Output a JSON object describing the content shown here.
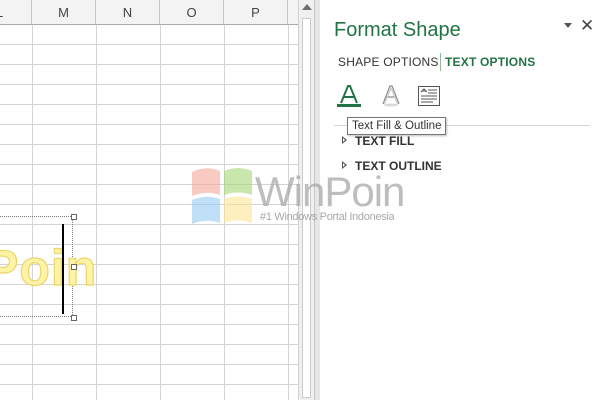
{
  "sheet": {
    "columns": [
      "L",
      "M",
      "N",
      "O",
      "P"
    ],
    "textbox_text": "Poin"
  },
  "pane": {
    "title": "Format Shape",
    "close_glyph": "✕",
    "tabs": [
      {
        "label": "SHAPE OPTIONS",
        "active": false
      },
      {
        "label": "TEXT OPTIONS",
        "active": true
      }
    ],
    "icons": [
      {
        "name": "text-fill-outline-icon",
        "selected": true
      },
      {
        "name": "text-effects-icon",
        "selected": false
      },
      {
        "name": "textbox-layout-icon",
        "selected": false
      }
    ],
    "tooltip": "Text Fill & Outline",
    "sections": [
      {
        "label": "TEXT FILL",
        "expanded": false
      },
      {
        "label": "TEXT OUTLINE",
        "expanded": false
      }
    ]
  },
  "watermark": {
    "name": "WinPoin",
    "tagline": "#1 Windows Portal Indonesia"
  },
  "colors": {
    "accent": "#217346",
    "textbox_fill": "#fff3a6",
    "gridline": "#d4d4d4"
  }
}
